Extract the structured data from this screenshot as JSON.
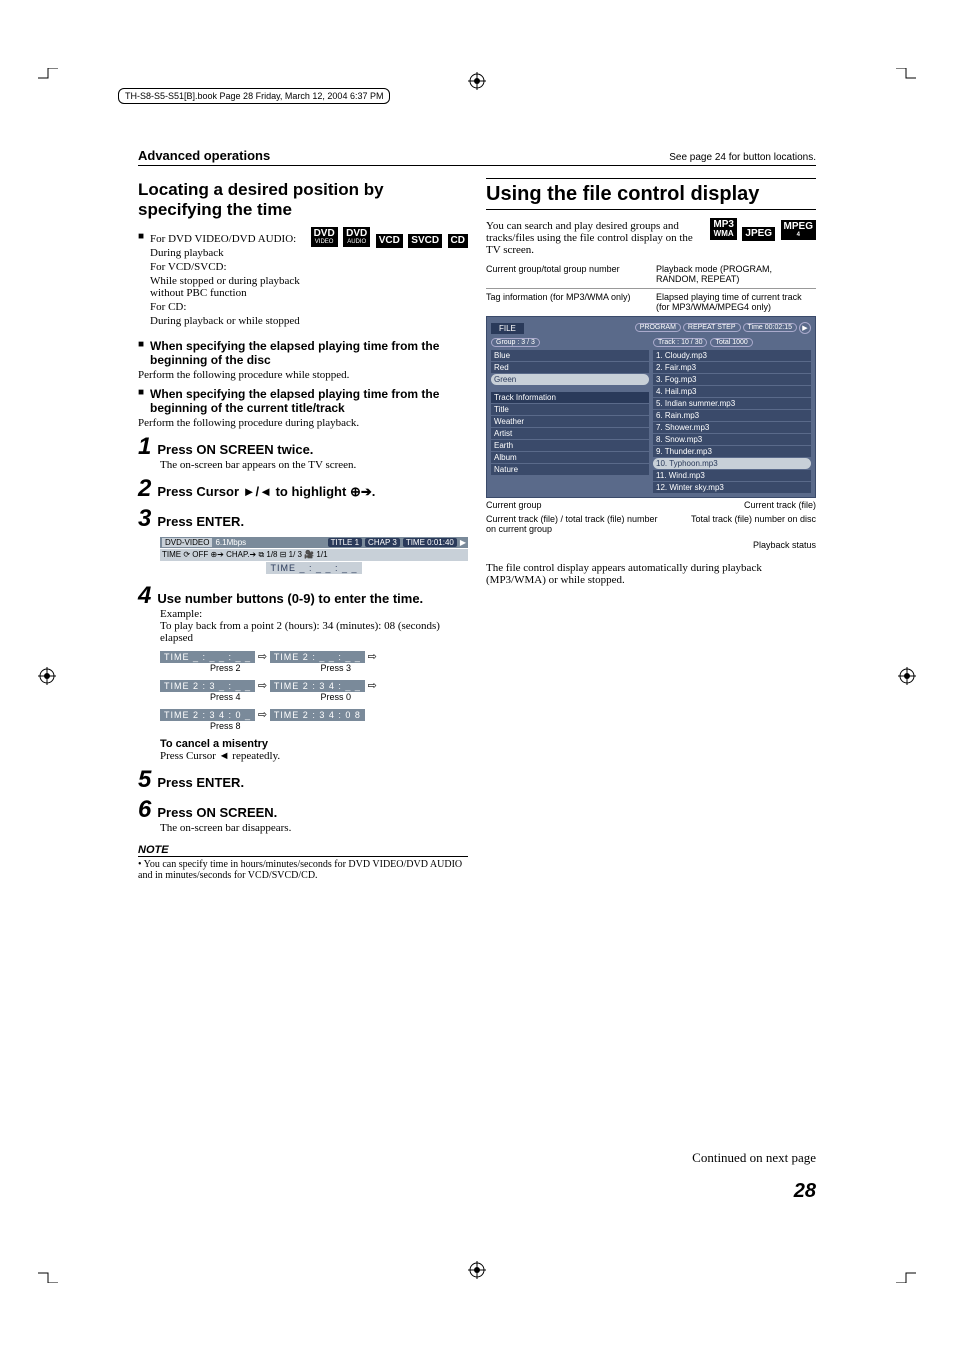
{
  "header_path": "TH-S8-S5-S51[B].book  Page 28  Friday, March 12, 2004  6:37 PM",
  "section_header": "Advanced operations",
  "see_page": "See page 24 for button locations.",
  "left": {
    "title": "Locating a desired position by specifying the time",
    "badges": [
      "DVD VIDEO",
      "DVD AUDIO",
      "VCD",
      "SVCD",
      "CD"
    ],
    "for1_label": "For DVD VIDEO/DVD AUDIO:",
    "for1_text": "During playback",
    "for2_label": "For VCD/SVCD:",
    "for2_text": "While stopped or during playback without PBC function",
    "for3_label": "For CD:",
    "for3_text": "During playback or while stopped",
    "sub1": "When specifying the elapsed playing time from the beginning of the disc",
    "perform1": "Perform the following procedure while stopped.",
    "sub2": "When specifying the elapsed playing time from the beginning of the current title/track",
    "perform2": "Perform the following procedure during playback.",
    "step1": "Press ON SCREEN twice.",
    "step1_sub": "The on-screen bar appears on the TV screen.",
    "step2": "Press Cursor ►/◄ to highlight ⊕➔.",
    "step3": "Press ENTER.",
    "osd": {
      "dvd_video": "DVD-VIDEO",
      "bitrate": "6.1Mbps",
      "title": "TITLE  1",
      "chap": "CHAP  3",
      "time": "TIME   0:01:40",
      "row2": "TIME ⟳ OFF   ⊕➔  CHAP.➔  ⧉ 1/8  ⊟ 1/ 3  🎥 1/1",
      "row3": "TIME  _ : _ _ : _ _"
    },
    "step4": "Use number buttons (0-9) to enter the time.",
    "example_label": "Example:",
    "example_text": "To play back from a point 2 (hours): 34 (minutes): 08 (seconds) elapsed",
    "time_seq": [
      {
        "a": "TIME  _ : _ _ : _ _",
        "b": "TIME  2 : _ _ : _ _",
        "pa": "Press 2",
        "pb": "Press 3"
      },
      {
        "a": "TIME  2 : 3 _ : _ _",
        "b": "TIME  2 : 3 4 : _ _",
        "pa": "Press 4",
        "pb": "Press 0"
      },
      {
        "a": "TIME  2 : 3 4 : 0 _",
        "b": "TIME  2 : 3 4 : 0 8",
        "pa": "Press 8",
        "pb": ""
      }
    ],
    "cancel_head": "To cancel a misentry",
    "cancel_text": "Press Cursor ◄ repeatedly.",
    "step5": "Press ENTER.",
    "step6": "Press ON SCREEN.",
    "step6_sub": "The on-screen bar disappears.",
    "note_head": "NOTE",
    "note_body": "• You can specify time in hours/minutes/seconds for DVD VIDEO/DVD AUDIO and in minutes/seconds for VCD/SVCD/CD."
  },
  "right": {
    "title": "Using the file control display",
    "intro": "You can search and play desired groups and tracks/files using the file control display on the TV screen.",
    "badges": [
      "MP3 WMA",
      "JPEG",
      "MPEG 4"
    ],
    "callouts": {
      "top_left": "Current group/total group number",
      "top_right": "Playback mode (PROGRAM, RANDOM, REPEAT)",
      "mid_left": "Tag information (for MP3/WMA only)",
      "mid_right": "Elapsed playing time of current track (for MP3/WMA/MPEG4 only)",
      "bot_left": "Current group",
      "bot_mid": "Current track (file)",
      "bot_left2": "Current track (file) / total track (file) number on current group",
      "bot_right2": "Total track (file) number on disc",
      "bot_right": "Playback status"
    },
    "fcd": {
      "file_label": "FILE",
      "program": "PROGRAM",
      "repeat": "REPEAT STEP",
      "time": "Time 00:02:15",
      "group_label": "Group :  3 / 3",
      "track_label": "Track : 10 / 30",
      "total_label": "Total 1000",
      "groups": [
        "Blue",
        "Red",
        "Green"
      ],
      "tag_head": "Track Information",
      "tags": [
        {
          "k": "Title",
          "v": ""
        },
        {
          "k": "Weather",
          "v": ""
        },
        {
          "k": "Artist",
          "v": ""
        },
        {
          "k": "Earth",
          "v": ""
        },
        {
          "k": "Album",
          "v": ""
        },
        {
          "k": "Nature",
          "v": ""
        }
      ],
      "tracks": [
        "1. Cloudy.mp3",
        "2. Fair.mp3",
        "3. Fog.mp3",
        "4. Hail.mp3",
        "5. Indian summer.mp3",
        "6. Rain.mp3",
        "7. Shower.mp3",
        "8. Snow.mp3",
        "9. Thunder.mp3",
        "10. Typhoon.mp3",
        "11. Wind.mp3",
        "12. Winter sky.mp3"
      ],
      "selected_track_index": 9
    },
    "outro": "The file control display appears automatically during playback (MP3/WMA) or while stopped."
  },
  "continued": "Continued on next page",
  "page_number": "28"
}
